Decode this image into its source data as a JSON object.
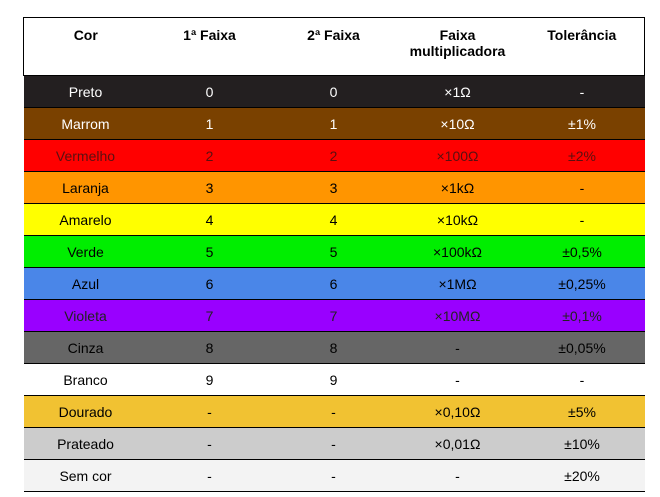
{
  "table": {
    "headers": [
      "Cor",
      "1ª Faixa",
      "2ª Faixa",
      "Faixa multiplicadora",
      "Tolerância"
    ],
    "rows": [
      {
        "cells": [
          "Preto",
          "0",
          "0",
          "×1Ω",
          "-"
        ],
        "bg": "#231f20",
        "fg": "#ffffff"
      },
      {
        "cells": [
          "Marrom",
          "1",
          "1",
          "×10Ω",
          "±1%"
        ],
        "bg": "#7a4100",
        "fg": "#ffffff"
      },
      {
        "cells": [
          "Vermelho",
          "2",
          "2",
          "×100Ω",
          "±2%"
        ],
        "bg": "#ff0000",
        "fg": "#5a1010"
      },
      {
        "cells": [
          "Laranja",
          "3",
          "3",
          "×1kΩ",
          "-"
        ],
        "bg": "#ff9500",
        "fg": "#000000"
      },
      {
        "cells": [
          "Amarelo",
          "4",
          "4",
          "×10kΩ",
          "-"
        ],
        "bg": "#ffff00",
        "fg": "#000000"
      },
      {
        "cells": [
          "Verde",
          "5",
          "5",
          "×100kΩ",
          "±0,5%"
        ],
        "bg": "#00ee00",
        "fg": "#000000"
      },
      {
        "cells": [
          "Azul",
          "6",
          "6",
          "×1MΩ",
          "±0,25%"
        ],
        "bg": "#4a86e8",
        "fg": "#000000"
      },
      {
        "cells": [
          "Violeta",
          "7",
          "7",
          "×10MΩ",
          "±0,1%"
        ],
        "bg": "#9900ff",
        "fg": "#222222"
      },
      {
        "cells": [
          "Cinza",
          "8",
          "8",
          "-",
          "±0,05%"
        ],
        "bg": "#666666",
        "fg": "#000000"
      },
      {
        "cells": [
          "Branco",
          "9",
          "9",
          "-",
          "-"
        ],
        "bg": "#ffffff",
        "fg": "#000000"
      },
      {
        "cells": [
          "Dourado",
          "-",
          "-",
          "×0,10Ω",
          "±5%"
        ],
        "bg": "#f1c232",
        "fg": "#000000"
      },
      {
        "cells": [
          "Prateado",
          "-",
          "-",
          "×0,01Ω",
          "±10%"
        ],
        "bg": "#cccccc",
        "fg": "#000000"
      },
      {
        "cells": [
          "Sem cor",
          "-",
          "-",
          "-",
          "±20%"
        ],
        "bg": "#f3f3f3",
        "fg": "#000000"
      }
    ]
  }
}
